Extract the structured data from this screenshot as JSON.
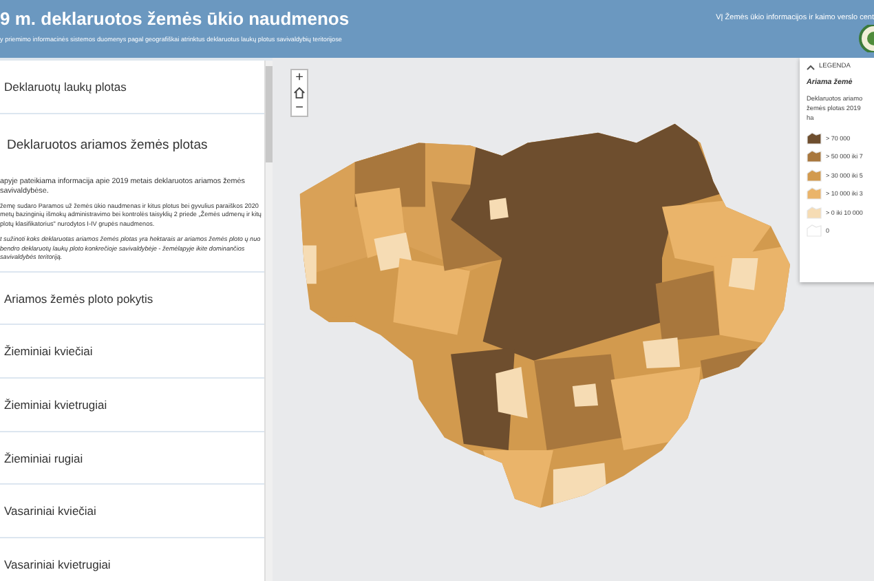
{
  "header": {
    "title": "9 m. deklaruotos žemės ūkio naudmenos",
    "subtitle": "y priemimo informacinės sistemos duomenys pagal geografiškai atrinktus deklaruotus laukų plotus savivaldybių teritorijose",
    "organization": "VĮ Žemės ūkio informacijos ir kaimo verslo cent"
  },
  "sidebar": {
    "items": [
      {
        "label": "Deklaruotų laukų plotas",
        "expanded": false
      },
      {
        "label": "Deklaruotos ariamos žemės plotas",
        "expanded": true,
        "paragraphs": [
          {
            "kind": "normal",
            "text": "apyje pateikiama informacija apie 2019 metais deklaruotos ariamos žemės savivaldybėse."
          },
          {
            "kind": "small",
            "text": "žemę sudaro Paramos už žemės ūkio naudmenas ir kitus plotus bei gyvulius paraiškos 2020 metų bazinginių išmokų administravimo bei kontrolės taisyklių 2 priede „Žemės udmenų ir kitų plotų klasifikatorius\" nurodytos I-IV grupės naudmenos."
          },
          {
            "kind": "note",
            "text": "t sužinoti koks deklaruotas ariamos žemės plotas yra hektarais ar ariamos žemės ploto ų nuo bendro deklaruotų laukų ploto konkrečioje savivaldybėje - žemėlapyje ikite dominančios savivaldybės teritoriją."
          }
        ]
      },
      {
        "label": "Ariamos žemės ploto pokytis",
        "expanded": false
      },
      {
        "label": "Žieminiai kviečiai",
        "expanded": false
      },
      {
        "label": "Žieminiai kvietrugiai",
        "expanded": false
      },
      {
        "label": "Žieminiai rugiai",
        "expanded": false
      },
      {
        "label": "Vasariniai kviečiai",
        "expanded": false
      },
      {
        "label": "Vasariniai kvietrugiai",
        "expanded": false
      }
    ]
  },
  "map": {
    "zoom_in": "+",
    "zoom_out": "−",
    "legend": {
      "heading": "LEGENDA",
      "title": "Ariama žemė",
      "description_lines": [
        "Deklaruotos ariamo",
        "žemės plotas 2019",
        "ha"
      ],
      "items": [
        {
          "label": "> 70 000",
          "color": "#6e4e2e"
        },
        {
          "label": "> 50 000 iki 7",
          "color": "#a8773d"
        },
        {
          "label": "> 30 000 iki 5",
          "color": "#d29a4e"
        },
        {
          "label": "> 10 000 iki 3",
          "color": "#eab46a"
        },
        {
          "label": "> 0 iki 10 000",
          "color": "#f6dcb4"
        },
        {
          "label": "0",
          "color": "#ffffff"
        }
      ]
    }
  }
}
